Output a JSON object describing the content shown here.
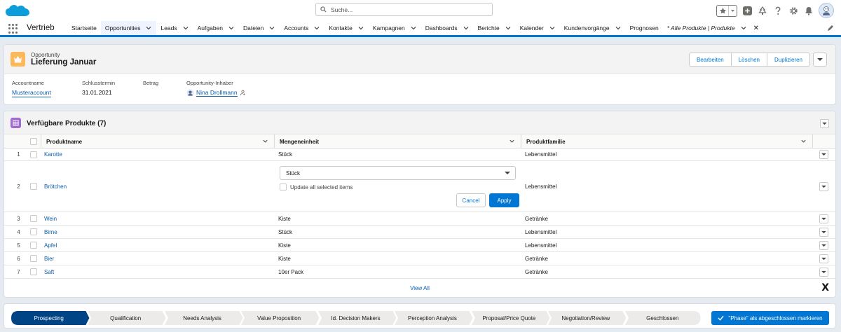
{
  "header": {
    "search_placeholder": "Suche...",
    "icons": [
      "cloud-logo-icon",
      "search-icon",
      "star-icon",
      "chevron-down-icon",
      "add-icon",
      "trailhead-icon",
      "help-icon",
      "gear-icon",
      "bell-icon",
      "avatar"
    ]
  },
  "nav": {
    "app_name": "Vertrieb",
    "items": [
      {
        "label": "Startseite",
        "chevron": false
      },
      {
        "label": "Opportunities",
        "chevron": true,
        "active": true
      },
      {
        "label": "Leads",
        "chevron": true
      },
      {
        "label": "Aufgaben",
        "chevron": true
      },
      {
        "label": "Dateien",
        "chevron": true
      },
      {
        "label": "Accounts",
        "chevron": true
      },
      {
        "label": "Kontakte",
        "chevron": true
      },
      {
        "label": "Kampagnen",
        "chevron": true
      },
      {
        "label": "Dashboards",
        "chevron": true
      },
      {
        "label": "Berichte",
        "chevron": true
      },
      {
        "label": "Kalender",
        "chevron": true
      },
      {
        "label": "Kundenvorgänge",
        "chevron": true
      },
      {
        "label": "Prognosen",
        "chevron": false
      },
      {
        "label": "* Alle Produkte | Produkte",
        "chevron": true,
        "closable": true
      }
    ]
  },
  "record": {
    "object_label": "Opportunity",
    "title": "Lieferung Januar",
    "buttons": {
      "edit": "Bearbeiten",
      "delete": "Löschen",
      "clone": "Duplizieren"
    },
    "fields": {
      "account_label": "Accountname",
      "account_value": "Musteraccount",
      "close_date_label": "Schlusstermin",
      "close_date_value": "31.01.2021",
      "amount_label": "Betrag",
      "amount_value": "",
      "owner_label": "Opportunity-Inhaber",
      "owner_value": "Nina Drollmann"
    }
  },
  "related_list": {
    "title": "Verfügbare Produkte (7)",
    "columns": {
      "name": "Produktname",
      "unit": "Mengeneinheit",
      "family": "Produktfamilie"
    },
    "rows": [
      {
        "num": "1",
        "name": "Karotte",
        "unit": "Stück",
        "family": "Lebensmittel"
      },
      {
        "num": "2",
        "name": "Brötchen",
        "unit": "",
        "family": "Lebensmittel"
      },
      {
        "num": "3",
        "name": "Wein",
        "unit": "Kiste",
        "family": "Getränke"
      },
      {
        "num": "4",
        "name": "Birne",
        "unit": "Stück",
        "family": "Lebensmittel"
      },
      {
        "num": "5",
        "name": "Apfel",
        "unit": "Kiste",
        "family": "Lebensmittel"
      },
      {
        "num": "6",
        "name": "Bier",
        "unit": "Kiste",
        "family": "Getränke"
      },
      {
        "num": "7",
        "name": "Saft",
        "unit": "10er Pack",
        "family": "Getränke"
      }
    ],
    "inline_edit": {
      "selected_value": "Stück",
      "update_all_label": "Update all selected items",
      "cancel_label": "Cancel",
      "apply_label": "Apply"
    },
    "view_all": "View All",
    "close_glyph": "X"
  },
  "path": {
    "steps": [
      "Prospecting",
      "Qualification",
      "Needs Analysis",
      "Value Proposition",
      "Id. Decision Makers",
      "Perception Analysis",
      "Proposal/Price Quote",
      "Negotiation/Review",
      "Geschlossen"
    ],
    "current_index": 0,
    "mark_button": "\"Phase\" als abgeschlossen markieren"
  },
  "colors": {
    "brand": "#0176d3",
    "link": "#0b5cab",
    "path_current": "#014486",
    "opportunity_icon": "#fcb95b",
    "product_icon": "#a06ad1"
  }
}
